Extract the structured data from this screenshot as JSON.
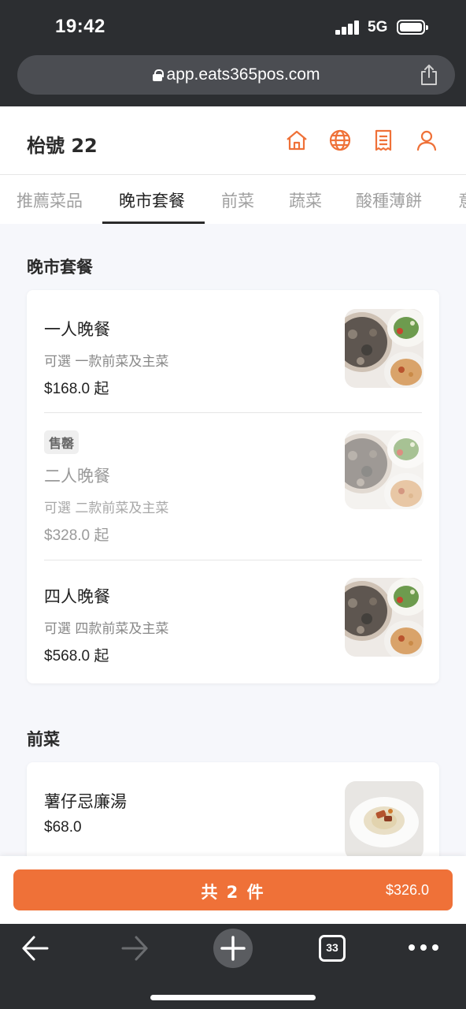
{
  "status_bar": {
    "time": "19:42",
    "network": "5G"
  },
  "browser": {
    "url": "app.eats365pos.com",
    "tab_count": "33"
  },
  "header": {
    "title": "枱號 22"
  },
  "tabs": [
    {
      "label": "推薦菜品"
    },
    {
      "label": "晚市套餐"
    },
    {
      "label": "前菜"
    },
    {
      "label": "蔬菜"
    },
    {
      "label": "酸種薄餅"
    },
    {
      "label": "意"
    }
  ],
  "active_tab": "晚市套餐",
  "sections": [
    {
      "title": "晚市套餐",
      "items": [
        {
          "name": "一人晚餐",
          "desc": "可選 一款前菜及主菜",
          "price": "$168.0 起"
        },
        {
          "badge": "售罄",
          "name": "二人晚餐",
          "desc": "可選 二款前菜及主菜",
          "price": "$328.0 起"
        },
        {
          "name": "四人晚餐",
          "desc": "可選 四款前菜及主菜",
          "price": "$568.0 起"
        }
      ]
    },
    {
      "title": "前菜",
      "items": [
        {
          "name": "薯仔忌廉湯",
          "price": "$68.0"
        }
      ]
    }
  ],
  "cart": {
    "label": "共 2 件",
    "total": "$326.0"
  },
  "colors": {
    "accent": "#ef7138",
    "chrome": "#2c2e31"
  }
}
